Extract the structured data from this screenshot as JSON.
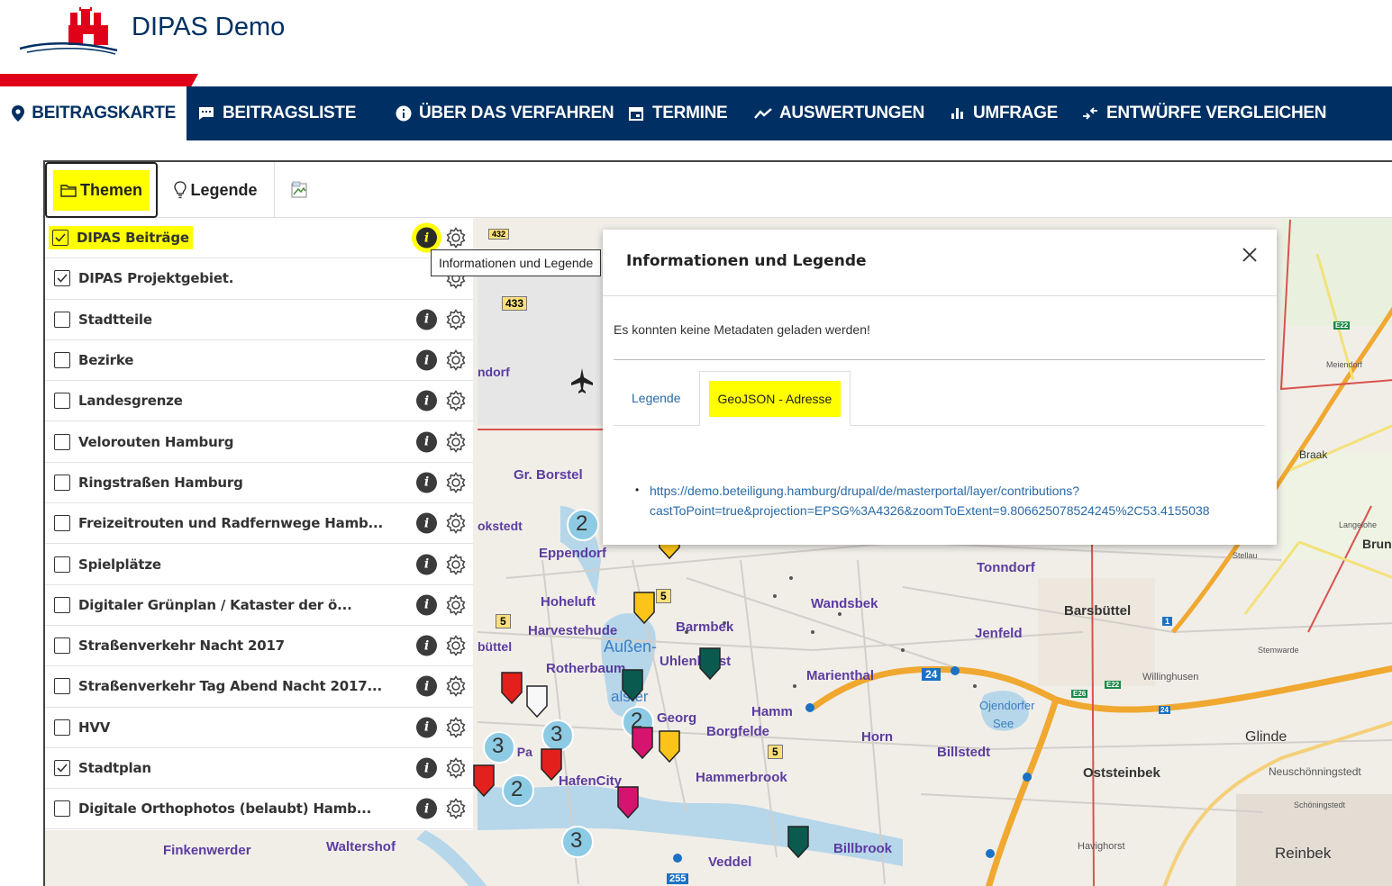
{
  "app": {
    "title": "DIPAS Demo"
  },
  "nav": {
    "items": [
      {
        "label": "BEITRAGSKARTE",
        "icon": "map-pin-icon"
      },
      {
        "label": "BEITRAGSLISTE",
        "icon": "message-icon"
      },
      {
        "label": "ÜBER DAS VERFAHREN",
        "icon": "info-icon"
      },
      {
        "label": "TERMINE",
        "icon": "calendar-icon"
      },
      {
        "label": "AUSWERTUNGEN",
        "icon": "trend-icon"
      },
      {
        "label": "UMFRAGE",
        "icon": "bar-chart-icon"
      },
      {
        "label": "ENTWÜRFE VERGLEICHEN",
        "icon": "compare-icon"
      }
    ]
  },
  "toolbar": {
    "themen_label": "Themen",
    "legende_label": "Legende"
  },
  "layers": [
    {
      "label": "DIPAS Beiträge",
      "checked": true
    },
    {
      "label": "DIPAS Projektgebiet.",
      "checked": true
    },
    {
      "label": "Stadtteile",
      "checked": false
    },
    {
      "label": "Bezirke",
      "checked": false
    },
    {
      "label": "Landesgrenze",
      "checked": false
    },
    {
      "label": "Velorouten Hamburg",
      "checked": false
    },
    {
      "label": "Ringstraßen Hamburg",
      "checked": false
    },
    {
      "label": "Freizeitrouten und Radfernwege Hamb...",
      "checked": false
    },
    {
      "label": "Spielplätze",
      "checked": false
    },
    {
      "label": "Digitaler Grünplan / Kataster der ö...",
      "checked": false
    },
    {
      "label": "Straßenverkehr Nacht 2017",
      "checked": false
    },
    {
      "label": "Straßenverkehr Tag Abend Nacht 2017...",
      "checked": false
    },
    {
      "label": "HVV",
      "checked": false
    },
    {
      "label": "Stadtplan",
      "checked": true
    },
    {
      "label": "Digitale Orthophotos (belaubt) Hamb...",
      "checked": false
    }
  ],
  "tooltip": {
    "text": "Informationen und Legende"
  },
  "modal": {
    "title": "Informationen und Legende",
    "message": "Es konnten keine Metadaten geladen werden!",
    "tabs": [
      {
        "label": "Legende",
        "active": false
      },
      {
        "label": "GeoJSON - Adresse",
        "active": true
      }
    ],
    "link_line1": "https://demo.beteiligung.hamburg/drupal/de/masterportal/layer/contributions?",
    "link_line2": "castToPoint=true&projection=EPSG%3A4326&zoomToExtent=9.806625078524245%2C53.4155038"
  },
  "map": {
    "places": [
      "Gr. Borstel",
      "Eppendorf",
      "Hoheluft",
      "Harvestehude",
      "Außen-",
      "alster",
      "Rotherbaum",
      "Uhlenhorst",
      "Barmbek",
      "Wandsbek",
      "Tonndorf",
      "Jenfeld",
      "Marienthal",
      "Hamm",
      "Borgfelde",
      "Horn",
      "Billstedt",
      "Hammerbrook",
      "HafenCity",
      "Veddel",
      "Billbrook",
      "Finkenwerder",
      "Waltershof",
      "Barsbüttel",
      "Glinde",
      "Oststeinbek",
      "Reinbek",
      "Braak",
      "Ojendorfer",
      "See",
      "Neuschönningstedt",
      "Havighorst",
      "Georg",
      "ndorf",
      "okstedt",
      "büttel",
      "Brunsb",
      "Willinghusen",
      "Stemwarde",
      "Meiendorf",
      "Stellau",
      "Langelohe",
      "Schöningstedt",
      "St. Pa"
    ],
    "road_badges": [
      "432",
      "433",
      "5",
      "5",
      "5",
      "24",
      "255",
      "E22",
      "E26",
      "E22",
      "1",
      "24"
    ],
    "clusters": [
      "2",
      "2",
      "3",
      "3",
      "2",
      "3"
    ],
    "colors": {
      "nav": "#003063",
      "accent_red": "#e10019",
      "highlight": "#ffff00",
      "link": "#2a6aa8",
      "marker_red": "#e3201b",
      "marker_yellow": "#fcc419",
      "marker_green": "#0b5a50",
      "marker_pink": "#d6146f",
      "cluster": "#8dcbe4"
    }
  }
}
